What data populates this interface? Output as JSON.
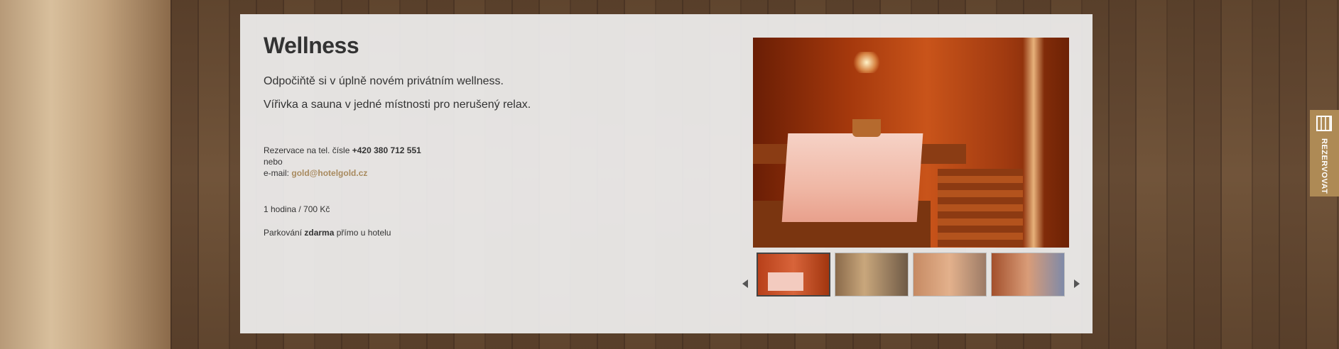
{
  "section": {
    "title": "Wellness",
    "intro_line1": "Odpočiňtě si v úplně novém privátním wellness.",
    "intro_line2": "Vířivka a sauna v jedné místnosti pro nerušený relax."
  },
  "contact": {
    "phone_prefix": "Rezervace na tel. čísle",
    "phone": "+420 380 712 551",
    "or": "nebo",
    "email_prefix": "e-mail:",
    "email": "gold@hotelgold.cz"
  },
  "price": "1 hodina / 700 Kč",
  "parking": {
    "prefix": "Parkování",
    "highlight": "zdarma",
    "suffix": "přímo u hotelu"
  },
  "gallery": {
    "thumbnail_count": 4,
    "active_index": 0
  },
  "reserve_button": {
    "label": "REZERVOVAT",
    "icon": "calendar-icon",
    "color": "#ae8a55"
  },
  "colors": {
    "accent": "#a88a5e",
    "text": "#333333"
  }
}
